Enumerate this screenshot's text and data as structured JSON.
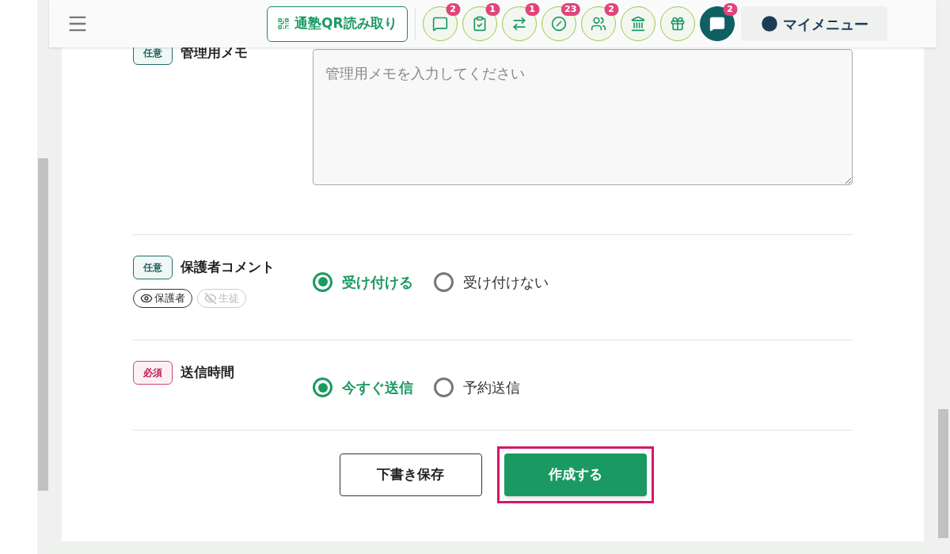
{
  "header": {
    "qr_button": "通塾QR読み取り",
    "icon_buttons": [
      {
        "kind": "chat",
        "badge": "2",
        "active": false
      },
      {
        "kind": "checklist",
        "badge": "1",
        "active": false
      },
      {
        "kind": "arrows",
        "badge": "1",
        "active": false
      },
      {
        "kind": "slashed",
        "badge": "23",
        "active": false
      },
      {
        "kind": "users",
        "badge": "2",
        "active": false
      },
      {
        "kind": "bank",
        "active": false
      },
      {
        "kind": "gift",
        "active": false
      },
      {
        "kind": "chat",
        "badge": "2",
        "active": true
      }
    ],
    "my_menu": "マイメニュー"
  },
  "form": {
    "rows": [
      {
        "kind": "textarea",
        "tag": {
          "kind": "optional",
          "text": "任意"
        },
        "label": "管理用メモ",
        "placeholder": "管理用メモを入力してください"
      },
      {
        "kind": "radio",
        "tag": {
          "kind": "optional",
          "text": "任意"
        },
        "label": "保護者コメント",
        "visibility": [
          {
            "text": "保護者",
            "visible": true
          },
          {
            "text": "生徒",
            "visible": false
          }
        ],
        "options": [
          {
            "label": "受け付ける",
            "selected": true
          },
          {
            "label": "受け付けない",
            "selected": false
          }
        ]
      },
      {
        "kind": "radio",
        "tag": {
          "kind": "required",
          "text": "必須"
        },
        "label": "送信時間",
        "options": [
          {
            "label": "今すぐ送信",
            "selected": true
          },
          {
            "label": "予約送信",
            "selected": false
          }
        ]
      }
    ]
  },
  "buttons": [
    {
      "kind": "secondary",
      "label": "下書き保存",
      "highlighted": false
    },
    {
      "kind": "primary",
      "label": "作成する",
      "highlighted": true
    }
  ]
}
